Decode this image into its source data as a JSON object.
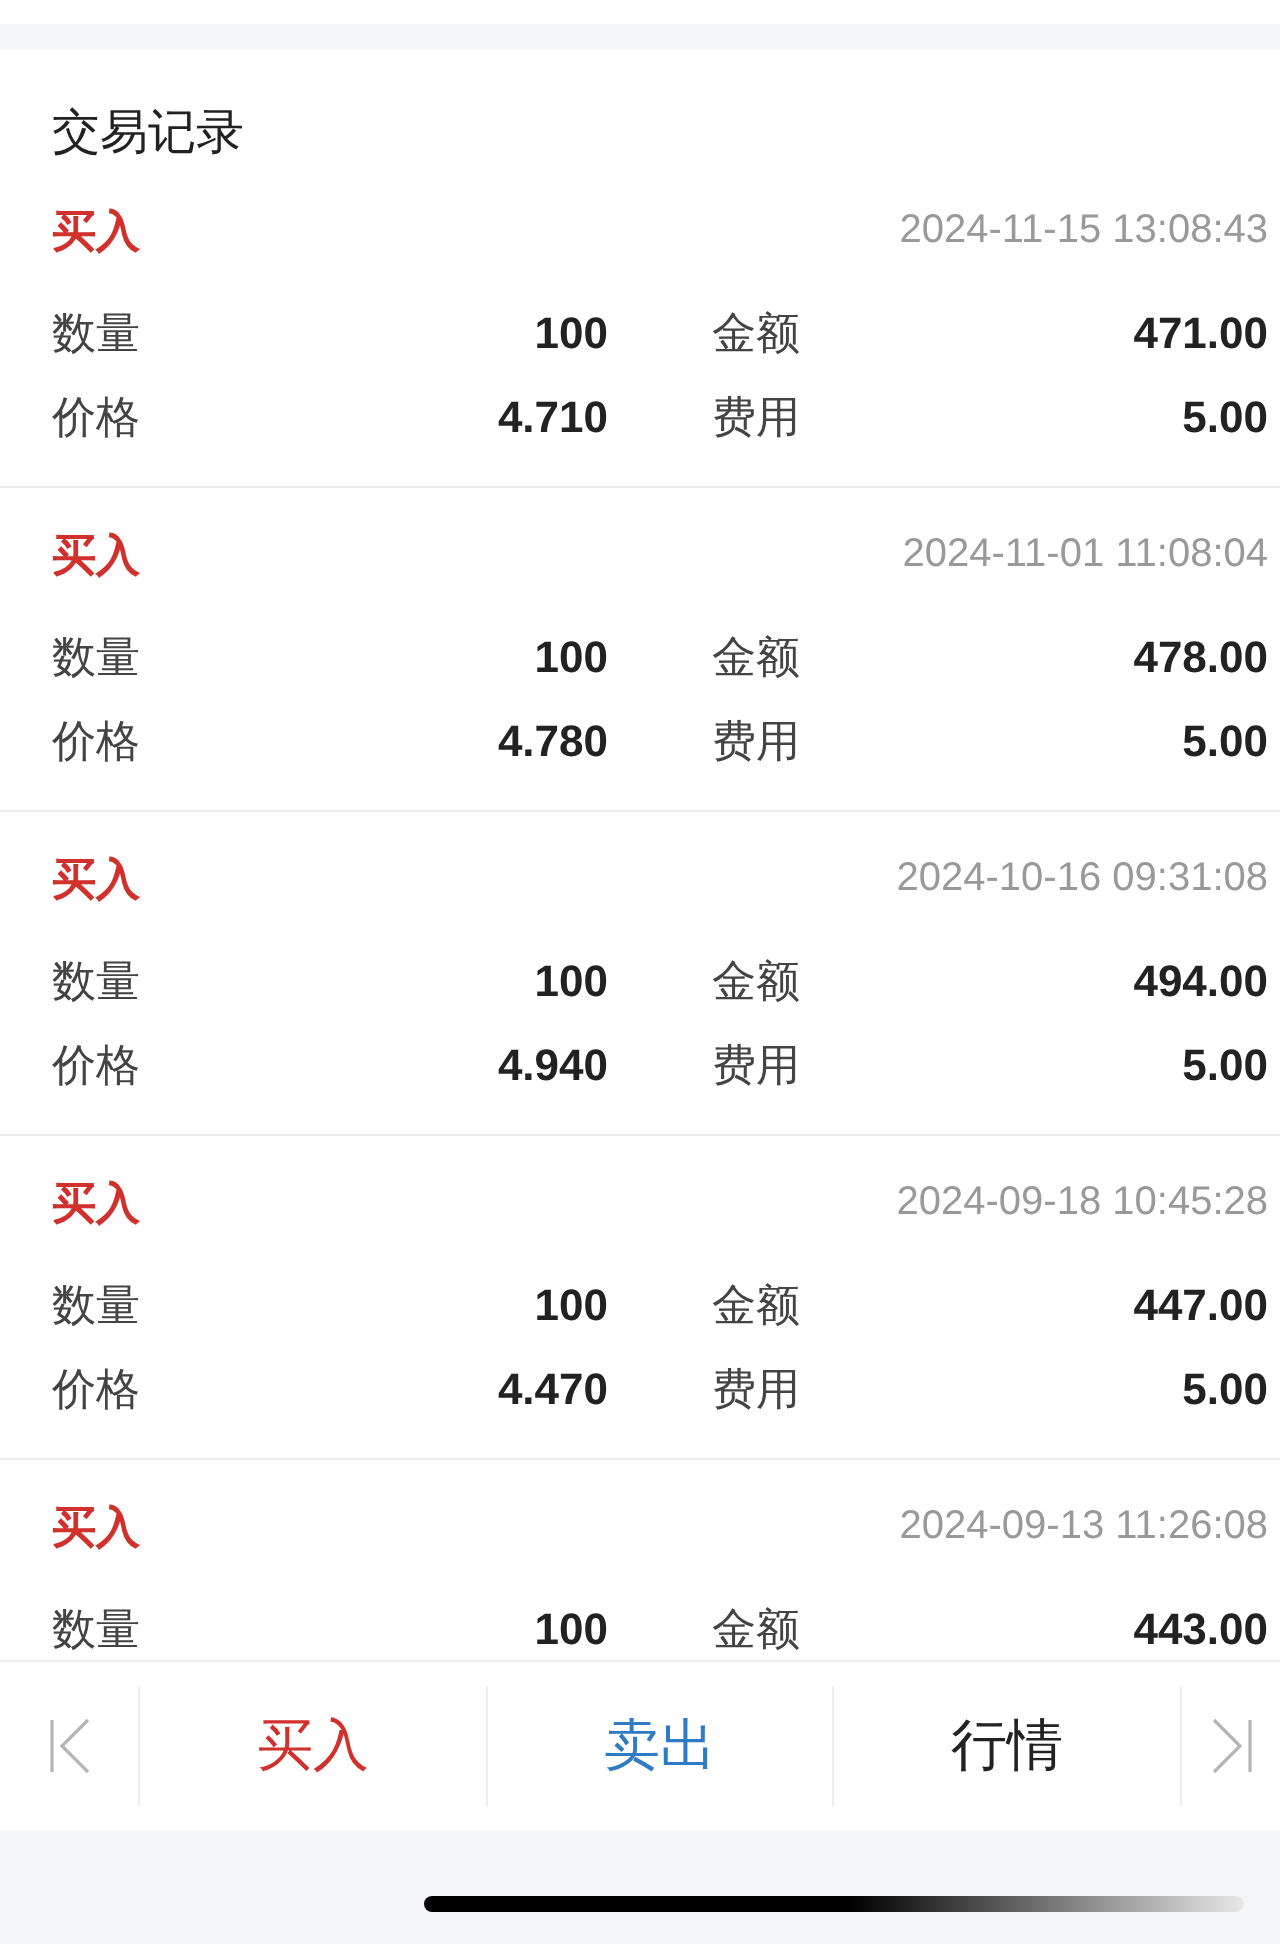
{
  "title": "交易记录",
  "records": [
    {
      "side": "买入",
      "kind": "buy",
      "time": "2024-11-15 13:08:43",
      "fields": [
        {
          "label": "数量",
          "value": "100"
        },
        {
          "label": "金额",
          "value": "471.00"
        },
        {
          "label": "价格",
          "value": "4.710"
        },
        {
          "label": "费用",
          "value": "5.00"
        }
      ]
    },
    {
      "side": "买入",
      "kind": "buy",
      "time": "2024-11-01 11:08:04",
      "fields": [
        {
          "label": "数量",
          "value": "100"
        },
        {
          "label": "金额",
          "value": "478.00"
        },
        {
          "label": "价格",
          "value": "4.780"
        },
        {
          "label": "费用",
          "value": "5.00"
        }
      ]
    },
    {
      "side": "买入",
      "kind": "buy",
      "time": "2024-10-16 09:31:08",
      "fields": [
        {
          "label": "数量",
          "value": "100"
        },
        {
          "label": "金额",
          "value": "494.00"
        },
        {
          "label": "价格",
          "value": "4.940"
        },
        {
          "label": "费用",
          "value": "5.00"
        }
      ]
    },
    {
      "side": "买入",
      "kind": "buy",
      "time": "2024-09-18 10:45:28",
      "fields": [
        {
          "label": "数量",
          "value": "100"
        },
        {
          "label": "金额",
          "value": "447.00"
        },
        {
          "label": "价格",
          "value": "4.470"
        },
        {
          "label": "费用",
          "value": "5.00"
        }
      ]
    },
    {
      "side": "买入",
      "kind": "buy",
      "time": "2024-09-13 11:26:08",
      "fields": [
        {
          "label": "数量",
          "value": "100"
        },
        {
          "label": "金额",
          "value": "443.00"
        }
      ]
    }
  ],
  "toolbar": [
    {
      "label": "买入",
      "color": "#d0312d"
    },
    {
      "label": "卖出",
      "color": "#2f7cc4"
    },
    {
      "label": "行情",
      "color": "#222222"
    }
  ]
}
